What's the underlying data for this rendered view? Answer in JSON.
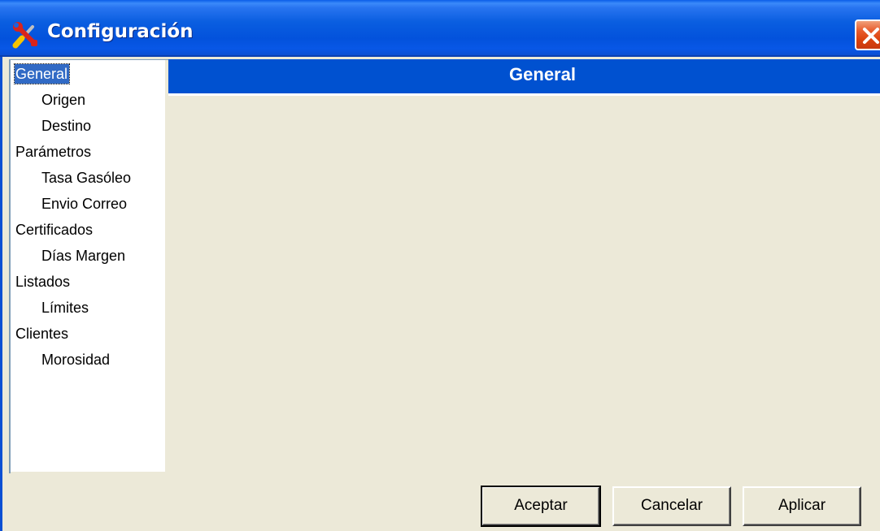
{
  "window": {
    "title": "Configuración",
    "title_icon": "tools-icon",
    "close_icon": "close-icon"
  },
  "nav": {
    "items": [
      {
        "label": "General",
        "level": 0,
        "selected": true
      },
      {
        "label": "Origen",
        "level": 1
      },
      {
        "label": "Destino",
        "level": 1
      },
      {
        "label": "Parámetros",
        "level": 0
      },
      {
        "label": "Tasa Gasóleo",
        "level": 1
      },
      {
        "label": "Envio Correo",
        "level": 1
      },
      {
        "label": "Certificados",
        "level": 0
      },
      {
        "label": "Días Margen",
        "level": 1
      },
      {
        "label": "Listados",
        "level": 0
      },
      {
        "label": "Límites",
        "level": 1
      },
      {
        "label": "Clientes",
        "level": 0
      },
      {
        "label": "Morosidad",
        "level": 1
      }
    ]
  },
  "panel": {
    "title": "General"
  },
  "buttons": {
    "accept": "Aceptar",
    "cancel": "Cancelar",
    "apply": "Aplicar"
  },
  "colors": {
    "titlebar": "#0352dc",
    "section_header": "#0051d0",
    "selection": "#316ac5",
    "background": "#ece9d8"
  }
}
